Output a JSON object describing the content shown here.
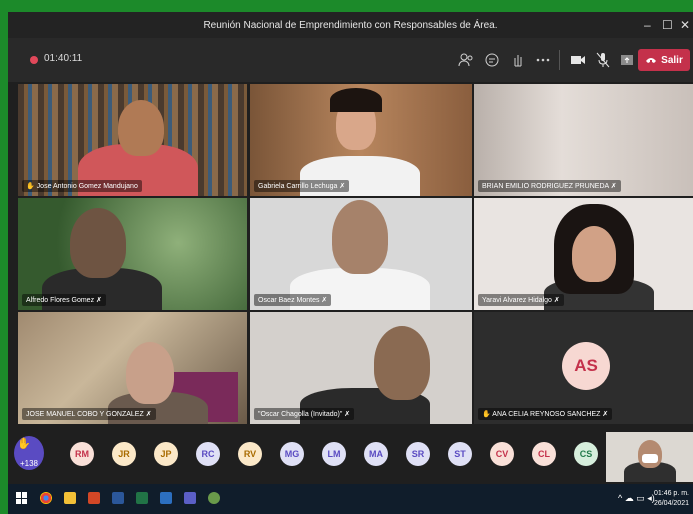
{
  "window": {
    "title": "Reunión Nacional de Emprendimiento con Responsables de Área.",
    "minimize": "–",
    "maximize": "☐",
    "close": "✕"
  },
  "toolbar": {
    "timer": "01:40:11",
    "leave_label": "Salir",
    "icons": [
      "participants-icon",
      "chat-icon",
      "raise-hand-icon",
      "more-icon",
      "camera-icon",
      "mic-muted-icon",
      "share-icon"
    ]
  },
  "participants": [
    {
      "name": "Jose Antonio Gomez Mandujano",
      "hand": true
    },
    {
      "name": "Gabriela Carrillo Lechuga",
      "muted": true
    },
    {
      "name": "BRIAN EMILIO RODRIGUEZ PRUNEDA",
      "muted": true
    },
    {
      "name": "Alfredo Flores Gomez",
      "muted": true
    },
    {
      "name": "Oscar Baez Montes",
      "muted": true
    },
    {
      "name": "Yaravi Alvarez Hidalgo",
      "muted": true
    },
    {
      "name": "JOSE MANUEL COBO Y GONZALEZ",
      "muted": true
    },
    {
      "name": "\"Oscar Chagolla (Invitado)\"",
      "muted": true
    },
    {
      "name": "ANA CELIA REYNOSO SANCHEZ",
      "hand": true,
      "muted": true,
      "initials": "AS"
    }
  ],
  "strip": {
    "overflow_count": "+138",
    "avatars": [
      "RM",
      "JR",
      "JP",
      "RC",
      "RV",
      "MG",
      "LM",
      "MA",
      "SR",
      "ST",
      "CV",
      "CL",
      "CS"
    ]
  },
  "taskbar": {
    "time": "01:46 p. m.",
    "date": "26/04/2021"
  }
}
